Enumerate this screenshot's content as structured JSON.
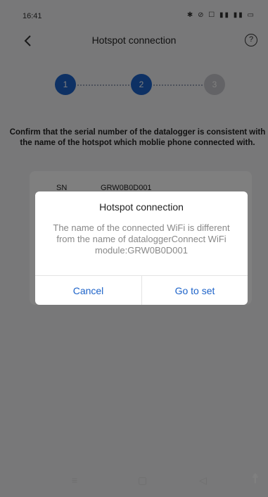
{
  "status_bar": {
    "time": "16:41",
    "icons": "✱ ⊘ ☐ ▮▮ ▮▮ ▭"
  },
  "header": {
    "back_icon": "back-chevron-icon",
    "title": "Hotspot connection",
    "help_icon_glyph": "?"
  },
  "stepper": {
    "steps": [
      "1",
      "2",
      "3"
    ],
    "active_step": 2,
    "active_color": "#1d63c9",
    "inactive_color": "#c7c7cc"
  },
  "instruction": "Confirm that the serial number of the datalogger is consistent with the name of the hotspot which moblie phone connected with.",
  "sn_card": {
    "label": "SN",
    "value": "GRW0B0D001"
  },
  "dialog": {
    "title": "Hotspot connection",
    "message": "The name of the connected WiFi is different from the name of dataloggerConnect WiFi module:GRW0B0D001",
    "cancel_label": "Cancel",
    "goto_label": "Go to set",
    "accent_color": "#1d63c9"
  },
  "nav_bar": {
    "menu_glyph": "≡",
    "home_glyph": "▢",
    "back_glyph": "◁",
    "accessibility_glyph": "☨"
  }
}
